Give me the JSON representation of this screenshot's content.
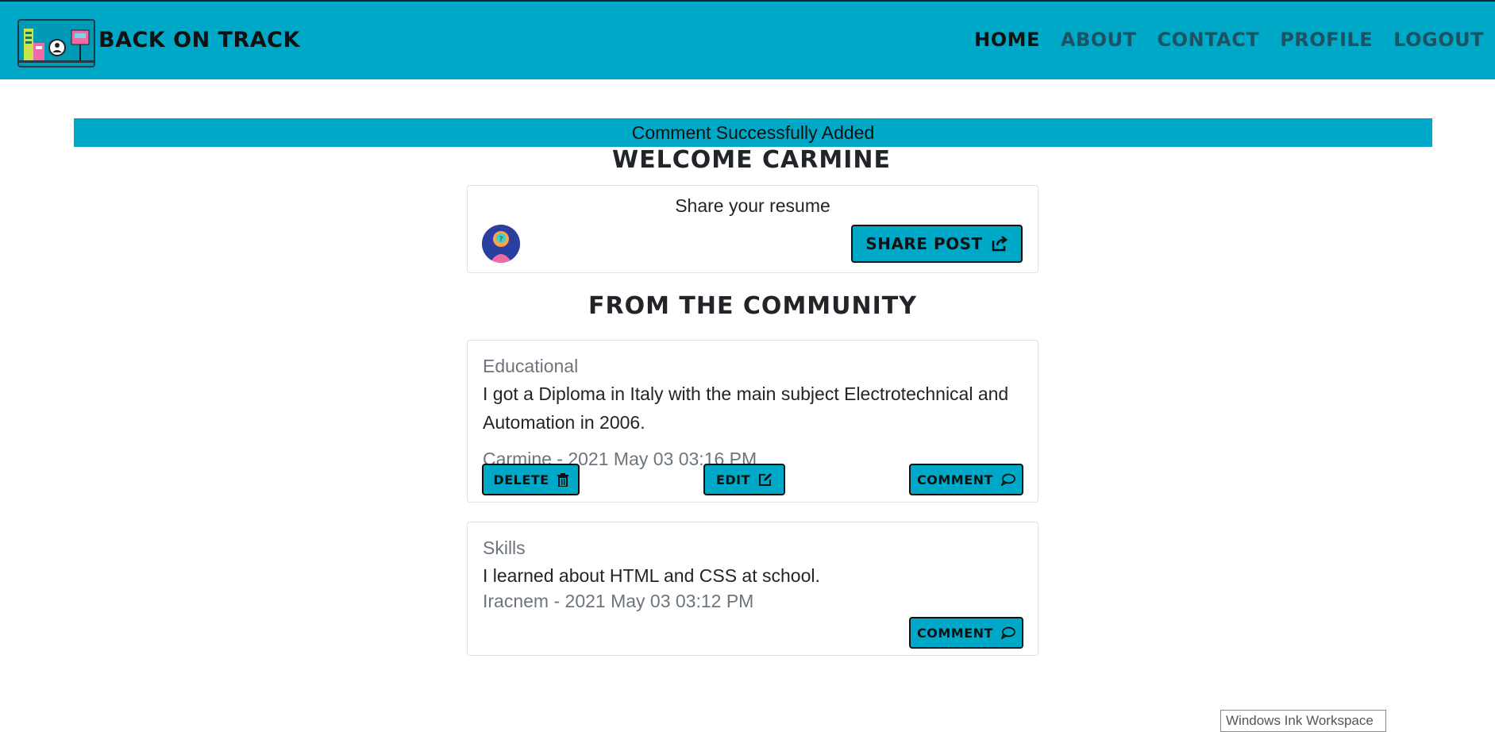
{
  "brand": {
    "name": "BACK ON TRACK"
  },
  "nav": {
    "items": [
      {
        "label": "HOME",
        "active": true
      },
      {
        "label": "ABOUT"
      },
      {
        "label": "CONTACT"
      },
      {
        "label": "PROFILE"
      },
      {
        "label": "LOGOUT"
      }
    ]
  },
  "alert": {
    "text": "Comment Successfully Added"
  },
  "welcome": {
    "title": "WELCOME CARMINE"
  },
  "share": {
    "title": "Share your resume",
    "button_label": "SHARE POST"
  },
  "community": {
    "title": "FROM THE COMMUNITY"
  },
  "posts": [
    {
      "category": "Educational",
      "body": "I got a Diploma in Italy with the main subject Electrotechnical and Automation in 2006.",
      "meta": "Carmine - 2021 May 03 03:16 PM",
      "delete_label": "DELETE",
      "edit_label": "EDIT",
      "comment_label": "COMMENT"
    },
    {
      "category": "Skills",
      "body": "I learned about HTML and CSS at school.",
      "meta": "Iracnem - 2021 May 03 03:12 PM",
      "comment_label": "COMMENT"
    }
  ],
  "overlay": {
    "ink_workspace": "Windows Ink Workspace"
  },
  "colors": {
    "accent": "#00a8c8",
    "text": "#212529",
    "muted": "#6c757d"
  }
}
